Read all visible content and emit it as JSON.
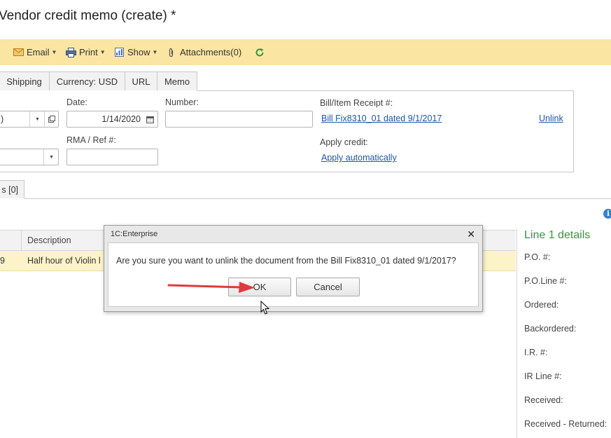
{
  "window": {
    "title": "Vendor credit memo (create) *"
  },
  "toolbar": {
    "email": "Email",
    "print": "Print",
    "show": "Show",
    "attachments": "Attachments(0)"
  },
  "tabs": [
    "Shipping",
    "Currency: USD",
    "URL",
    "Memo"
  ],
  "form": {
    "vendor_partial": ")",
    "date_label": "Date:",
    "date_value": "1/14/2020",
    "number_label": "Number:",
    "number_value": "",
    "rma_label": "RMA / Ref #:",
    "rma_value": "",
    "bill_receipt_label": "Bill/Item Receipt #:",
    "bill_link": "Bill Fix8310_01 dated 9/1/2017",
    "unlink": "Unlink",
    "apply_credit_label": "Apply credit:",
    "apply_auto_link": "Apply automatically"
  },
  "subtab": {
    "label": "s [0]"
  },
  "grid": {
    "columns": [
      "Description"
    ],
    "rows": [
      {
        "num": "9",
        "description": "Half hour of Violin l"
      }
    ]
  },
  "details": {
    "title": "Line 1 details",
    "labels": [
      "P.O. #:",
      "P.O.Line #:",
      "Ordered:",
      "Backordered:",
      "I.R. #:",
      "IR Line #:",
      "Received:",
      "Received - Returned:"
    ]
  },
  "dialog": {
    "title": "1C:Enterprise",
    "message": "Are you sure you want to unlink the document from the Bill Fix8310_01 dated 9/1/2017?",
    "ok": "OK",
    "cancel": "Cancel"
  },
  "colors": {
    "toolbar_bg": "#fbe5a2",
    "link": "#1d56a8",
    "details_title": "#2e9a3b",
    "arrow": "#e03a3e",
    "row_highlight": "#fdf3c9"
  },
  "icons": [
    "email-icon",
    "print-icon",
    "show-icon",
    "paperclip-icon",
    "refresh-icon",
    "info-icon",
    "calendar-icon",
    "open-icon",
    "close-icon",
    "mouse-cursor-icon"
  ]
}
